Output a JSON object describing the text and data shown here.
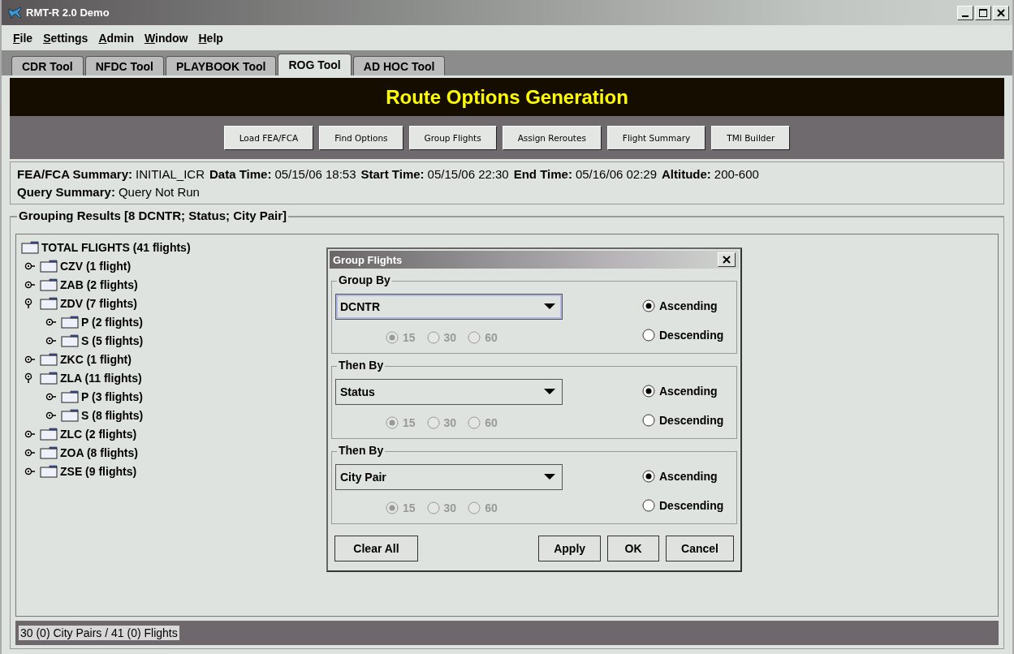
{
  "window": {
    "title": "RMT-R 2.0 Demo"
  },
  "menu": [
    "File",
    "Settings",
    "Admin",
    "Window",
    "Help"
  ],
  "tabs": [
    {
      "label": "CDR Tool",
      "selected": false
    },
    {
      "label": "NFDC Tool",
      "selected": false
    },
    {
      "label": "PLAYBOOK Tool",
      "selected": false
    },
    {
      "label": "ROG Tool",
      "selected": true
    },
    {
      "label": "AD HOC Tool",
      "selected": false
    }
  ],
  "header": {
    "title": "Route Options Generation"
  },
  "toolbar": [
    "Load FEA/FCA",
    "Find Options",
    "Group Flights",
    "Assign Reroutes",
    "Flight Summary",
    "TMI Builder"
  ],
  "summary": [
    [
      {
        "label": "FEA/FCA Summary:",
        "value": "INITIAL_ICR"
      },
      {
        "label": "Data Time:",
        "value": "05/15/06 18:53"
      },
      {
        "label": "Start Time:",
        "value": "05/15/06 22:30"
      },
      {
        "label": "End Time:",
        "value": "05/16/06 02:29"
      },
      {
        "label": "Altitude:",
        "value": "200-600"
      }
    ],
    [
      {
        "label": "Query Summary:",
        "value": "Query Not Run"
      }
    ]
  ],
  "grouping": {
    "title": "Grouping Results [8 DCNTR; Status; City Pair]",
    "tree": {
      "label": "TOTAL FLIGHTS (41 flights)",
      "children": [
        {
          "label": "CZV (1 flight)",
          "expanded": false
        },
        {
          "label": "ZAB (2 flights)",
          "expanded": false
        },
        {
          "label": "ZDV (7 flights)",
          "expanded": true,
          "children": [
            {
              "label": "P (2 flights)",
              "expanded": false
            },
            {
              "label": "S (5 flights)",
              "expanded": false
            }
          ]
        },
        {
          "label": "ZKC (1 flight)",
          "expanded": false
        },
        {
          "label": "ZLA (11 flights)",
          "expanded": true,
          "children": [
            {
              "label": "P (3 flights)",
              "expanded": false
            },
            {
              "label": "S (8 flights)",
              "expanded": false
            }
          ]
        },
        {
          "label": "ZLC (2 flights)",
          "expanded": false
        },
        {
          "label": "ZOA (8 flights)",
          "expanded": false
        },
        {
          "label": "ZSE (9 flights)",
          "expanded": false
        }
      ]
    }
  },
  "status_bar": "30 (0) City Pairs / 41 (0) Flights",
  "dialog": {
    "title": "Group Flights",
    "sections": [
      {
        "title": "Group By",
        "value": "DCNTR",
        "focused": true,
        "intervals_disabled": true,
        "intervals": [
          {
            "label": "15",
            "selected": true
          },
          {
            "label": "30",
            "selected": false
          },
          {
            "label": "60",
            "selected": false
          }
        ],
        "order": [
          {
            "label": "Ascending",
            "selected": true
          },
          {
            "label": "Descending",
            "selected": false
          }
        ]
      },
      {
        "title": "Then By",
        "value": "Status",
        "focused": false,
        "intervals_disabled": true,
        "intervals": [
          {
            "label": "15",
            "selected": true
          },
          {
            "label": "30",
            "selected": false
          },
          {
            "label": "60",
            "selected": false
          }
        ],
        "order": [
          {
            "label": "Ascending",
            "selected": true
          },
          {
            "label": "Descending",
            "selected": false
          }
        ]
      },
      {
        "title": "Then By",
        "value": "City Pair",
        "focused": false,
        "intervals_disabled": true,
        "intervals": [
          {
            "label": "15",
            "selected": true
          },
          {
            "label": "30",
            "selected": false
          },
          {
            "label": "60",
            "selected": false
          }
        ],
        "order": [
          {
            "label": "Ascending",
            "selected": true
          },
          {
            "label": "Descending",
            "selected": false
          }
        ]
      }
    ],
    "left_buttons": [
      "Clear All"
    ],
    "right_buttons": [
      "Apply",
      "OK",
      "Cancel"
    ]
  }
}
